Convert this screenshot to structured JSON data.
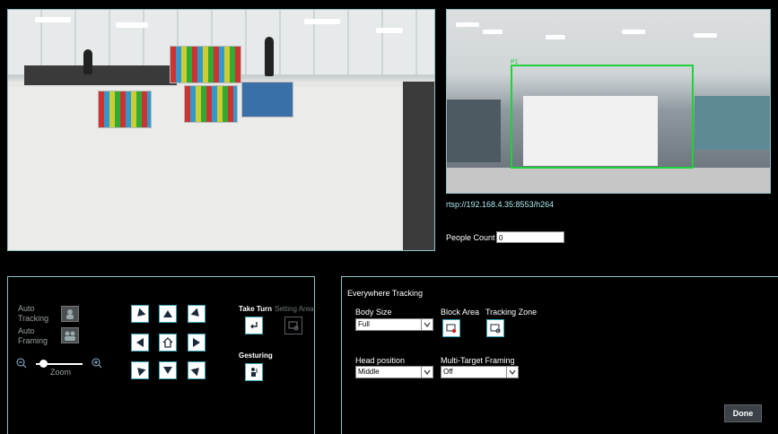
{
  "stream_url": "rtsp://192.168.4.35:8553/h264",
  "people_count": {
    "label": "People Count",
    "value": "0"
  },
  "preview": {
    "tracking_label": "P1",
    "tracking_color": "#1fd13a"
  },
  "camera_control": {
    "auto_tracking": "Auto\nTracking",
    "auto_framing": "Auto\nFraming",
    "zoom_label": "Zoom",
    "zoom_level": 0.5,
    "take_turn": "Take Turn",
    "setting_area": "Setting Area",
    "gesturing": "Gesturing"
  },
  "tracking": {
    "title": "Everywhere Tracking",
    "body_size_label": "Body Size",
    "body_size_value": "Full",
    "block_area_label": "Block Area",
    "tracking_zone_label": "Tracking Zone",
    "head_position_label": "Head position",
    "head_position_value": "Middle",
    "multi_target_label": "Multi-Target Framing",
    "multi_target_value": "Off"
  },
  "done_label": "Done",
  "colors": {
    "border": "#8fc3c7",
    "accent": "#3aa6b8",
    "url_text": "#aeeaf0"
  }
}
